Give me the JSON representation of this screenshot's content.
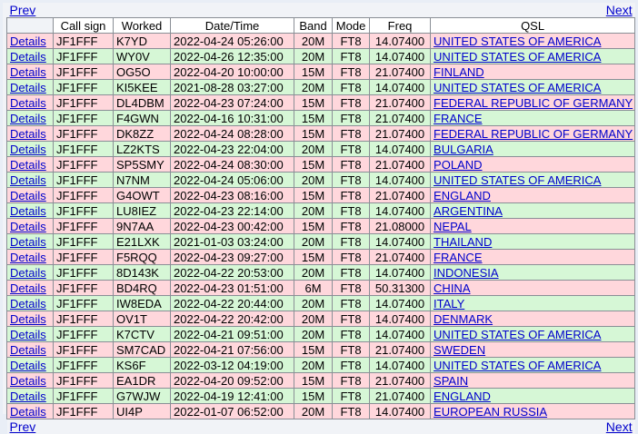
{
  "nav": {
    "prev": "Prev",
    "next": "Next"
  },
  "headers": [
    "",
    "Call sign",
    "Worked",
    "Date/Time",
    "Band",
    "Mode",
    "Freq",
    "QSL"
  ],
  "details_label": "Details",
  "rows": [
    {
      "call": "JF1FFF",
      "worked": "K7YD",
      "datetime": "2022-04-24 05:26:00",
      "band": "20M",
      "mode": "FT8",
      "freq": "14.07400",
      "qsl": "UNITED STATES OF AMERICA"
    },
    {
      "call": "JF1FFF",
      "worked": "WY0V",
      "datetime": "2022-04-26 12:35:00",
      "band": "20M",
      "mode": "FT8",
      "freq": "14.07400",
      "qsl": "UNITED STATES OF AMERICA"
    },
    {
      "call": "JF1FFF",
      "worked": "OG5O",
      "datetime": "2022-04-20 10:00:00",
      "band": "15M",
      "mode": "FT8",
      "freq": "21.07400",
      "qsl": "FINLAND"
    },
    {
      "call": "JF1FFF",
      "worked": "KI5KEE",
      "datetime": "2021-08-28 03:27:00",
      "band": "20M",
      "mode": "FT8",
      "freq": "14.07400",
      "qsl": "UNITED STATES OF AMERICA"
    },
    {
      "call": "JF1FFF",
      "worked": "DL4DBM",
      "datetime": "2022-04-23 07:24:00",
      "band": "15M",
      "mode": "FT8",
      "freq": "21.07400",
      "qsl": "FEDERAL REPUBLIC OF GERMANY"
    },
    {
      "call": "JF1FFF",
      "worked": "F4GWN",
      "datetime": "2022-04-16 10:31:00",
      "band": "15M",
      "mode": "FT8",
      "freq": "21.07400",
      "qsl": "FRANCE"
    },
    {
      "call": "JF1FFF",
      "worked": "DK8ZZ",
      "datetime": "2022-04-24 08:28:00",
      "band": "15M",
      "mode": "FT8",
      "freq": "21.07400",
      "qsl": "FEDERAL REPUBLIC OF GERMANY"
    },
    {
      "call": "JF1FFF",
      "worked": "LZ2KTS",
      "datetime": "2022-04-23 22:04:00",
      "band": "20M",
      "mode": "FT8",
      "freq": "14.07400",
      "qsl": "BULGARIA"
    },
    {
      "call": "JF1FFF",
      "worked": "SP5SMY",
      "datetime": "2022-04-24 08:30:00",
      "band": "15M",
      "mode": "FT8",
      "freq": "21.07400",
      "qsl": "POLAND"
    },
    {
      "call": "JF1FFF",
      "worked": "N7NM",
      "datetime": "2022-04-24 05:06:00",
      "band": "20M",
      "mode": "FT8",
      "freq": "14.07400",
      "qsl": "UNITED STATES OF AMERICA"
    },
    {
      "call": "JF1FFF",
      "worked": "G4OWT",
      "datetime": "2022-04-23 08:16:00",
      "band": "15M",
      "mode": "FT8",
      "freq": "21.07400",
      "qsl": "ENGLAND"
    },
    {
      "call": "JF1FFF",
      "worked": "LU8IEZ",
      "datetime": "2022-04-23 22:14:00",
      "band": "20M",
      "mode": "FT8",
      "freq": "14.07400",
      "qsl": "ARGENTINA"
    },
    {
      "call": "JF1FFF",
      "worked": "9N7AA",
      "datetime": "2022-04-23 00:42:00",
      "band": "15M",
      "mode": "FT8",
      "freq": "21.08000",
      "qsl": "NEPAL"
    },
    {
      "call": "JF1FFF",
      "worked": "E21LXK",
      "datetime": "2021-01-03 03:24:00",
      "band": "20M",
      "mode": "FT8",
      "freq": "14.07400",
      "qsl": "THAILAND"
    },
    {
      "call": "JF1FFF",
      "worked": "F5RQQ",
      "datetime": "2022-04-23 09:27:00",
      "band": "15M",
      "mode": "FT8",
      "freq": "21.07400",
      "qsl": "FRANCE"
    },
    {
      "call": "JF1FFF",
      "worked": "8D143K",
      "datetime": "2022-04-22 20:53:00",
      "band": "20M",
      "mode": "FT8",
      "freq": "14.07400",
      "qsl": "INDONESIA"
    },
    {
      "call": "JF1FFF",
      "worked": "BD4RQ",
      "datetime": "2022-04-23 01:51:00",
      "band": "6M",
      "mode": "FT8",
      "freq": "50.31300",
      "qsl": "CHINA"
    },
    {
      "call": "JF1FFF",
      "worked": "IW8EDA",
      "datetime": "2022-04-22 20:44:00",
      "band": "20M",
      "mode": "FT8",
      "freq": "14.07400",
      "qsl": "ITALY"
    },
    {
      "call": "JF1FFF",
      "worked": "OV1T",
      "datetime": "2022-04-22 20:42:00",
      "band": "20M",
      "mode": "FT8",
      "freq": "14.07400",
      "qsl": "DENMARK"
    },
    {
      "call": "JF1FFF",
      "worked": "K7CTV",
      "datetime": "2022-04-21 09:51:00",
      "band": "20M",
      "mode": "FT8",
      "freq": "14.07400",
      "qsl": "UNITED STATES OF AMERICA"
    },
    {
      "call": "JF1FFF",
      "worked": "SM7CAD",
      "datetime": "2022-04-21 07:56:00",
      "band": "15M",
      "mode": "FT8",
      "freq": "21.07400",
      "qsl": "SWEDEN"
    },
    {
      "call": "JF1FFF",
      "worked": "KS6F",
      "datetime": "2022-03-12 04:19:00",
      "band": "20M",
      "mode": "FT8",
      "freq": "14.07400",
      "qsl": "UNITED STATES OF AMERICA"
    },
    {
      "call": "JF1FFF",
      "worked": "EA1DR",
      "datetime": "2022-04-20 09:52:00",
      "band": "15M",
      "mode": "FT8",
      "freq": "21.07400",
      "qsl": "SPAIN"
    },
    {
      "call": "JF1FFF",
      "worked": "G7WJW",
      "datetime": "2022-04-19 12:41:00",
      "band": "15M",
      "mode": "FT8",
      "freq": "21.07400",
      "qsl": "ENGLAND"
    },
    {
      "call": "JF1FFF",
      "worked": "UI4P",
      "datetime": "2022-01-07 06:52:00",
      "band": "20M",
      "mode": "FT8",
      "freq": "14.07400",
      "qsl": "EUROPEAN RUSSIA"
    }
  ]
}
